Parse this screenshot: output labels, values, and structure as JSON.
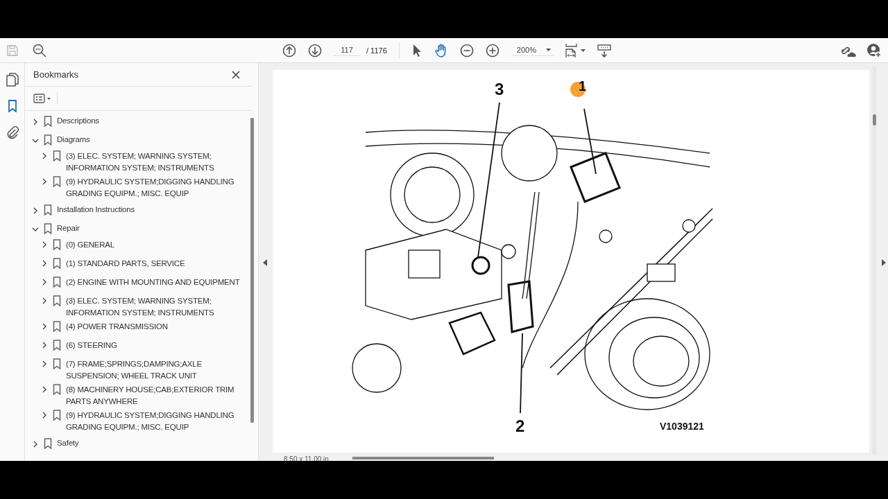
{
  "toolbar": {
    "page_number": "117",
    "page_total": "/ 1176",
    "zoom": "200%",
    "tools": [
      {
        "kind": "select",
        "selected": false
      },
      {
        "kind": "hand",
        "selected": true
      }
    ]
  },
  "rail": [
    {
      "kind": "pages",
      "selected": false
    },
    {
      "kind": "bookmarks",
      "selected": true
    },
    {
      "kind": "attachments",
      "selected": false
    }
  ],
  "bookmarks_panel": {
    "title": "Bookmarks",
    "items": [
      {
        "label": "Descriptions",
        "expanded": false
      },
      {
        "label": "Diagrams",
        "expanded": true,
        "children": [
          {
            "label": "(3) ELEC. SYSTEM; WARNING SYSTEM; INFORMATION SYSTEM; INSTRUMENTS",
            "expanded": false
          },
          {
            "label": "(9) HYDRAULIC SYSTEM;DIGGING HANDLING GRADING EQUIPM.; MISC. EQUIP",
            "expanded": false
          }
        ]
      },
      {
        "label": "Installation Instructions",
        "expanded": false
      },
      {
        "label": "Repair",
        "expanded": true,
        "children": [
          {
            "label": "(0) GENERAL",
            "expanded": false
          },
          {
            "label": "(1) STANDARD PARTS, SERVICE",
            "expanded": false
          },
          {
            "label": "(2) ENGINE WITH MOUNTING AND EQUIPMENT",
            "expanded": false
          },
          {
            "label": "(3) ELEC. SYSTEM; WARNING SYSTEM; INFORMATION SYSTEM; INSTRUMENTS",
            "expanded": false
          },
          {
            "label": "(4) POWER TRANSMISSION",
            "expanded": false
          },
          {
            "label": "(6) STEERING",
            "expanded": false
          },
          {
            "label": "(7) FRAME;SPRINGS;DAMPING;AXLE SUSPENSION; WHEEL TRACK UNIT",
            "expanded": false
          },
          {
            "label": "(8) MACHINERY HOUSE;CAB;EXTERIOR TRIM PARTS ANYWHERE",
            "expanded": false
          },
          {
            "label": "(9) HYDRAULIC SYSTEM;DIGGING HANDLING GRADING EQUIPM.; MISC. EQUIP",
            "expanded": false
          }
        ]
      },
      {
        "label": "Safety",
        "expanded": false
      }
    ]
  },
  "document": {
    "callouts": [
      "3",
      "1",
      "2"
    ],
    "figure_id": "V1039121",
    "page_size": "8.50 x 11.00 in"
  }
}
